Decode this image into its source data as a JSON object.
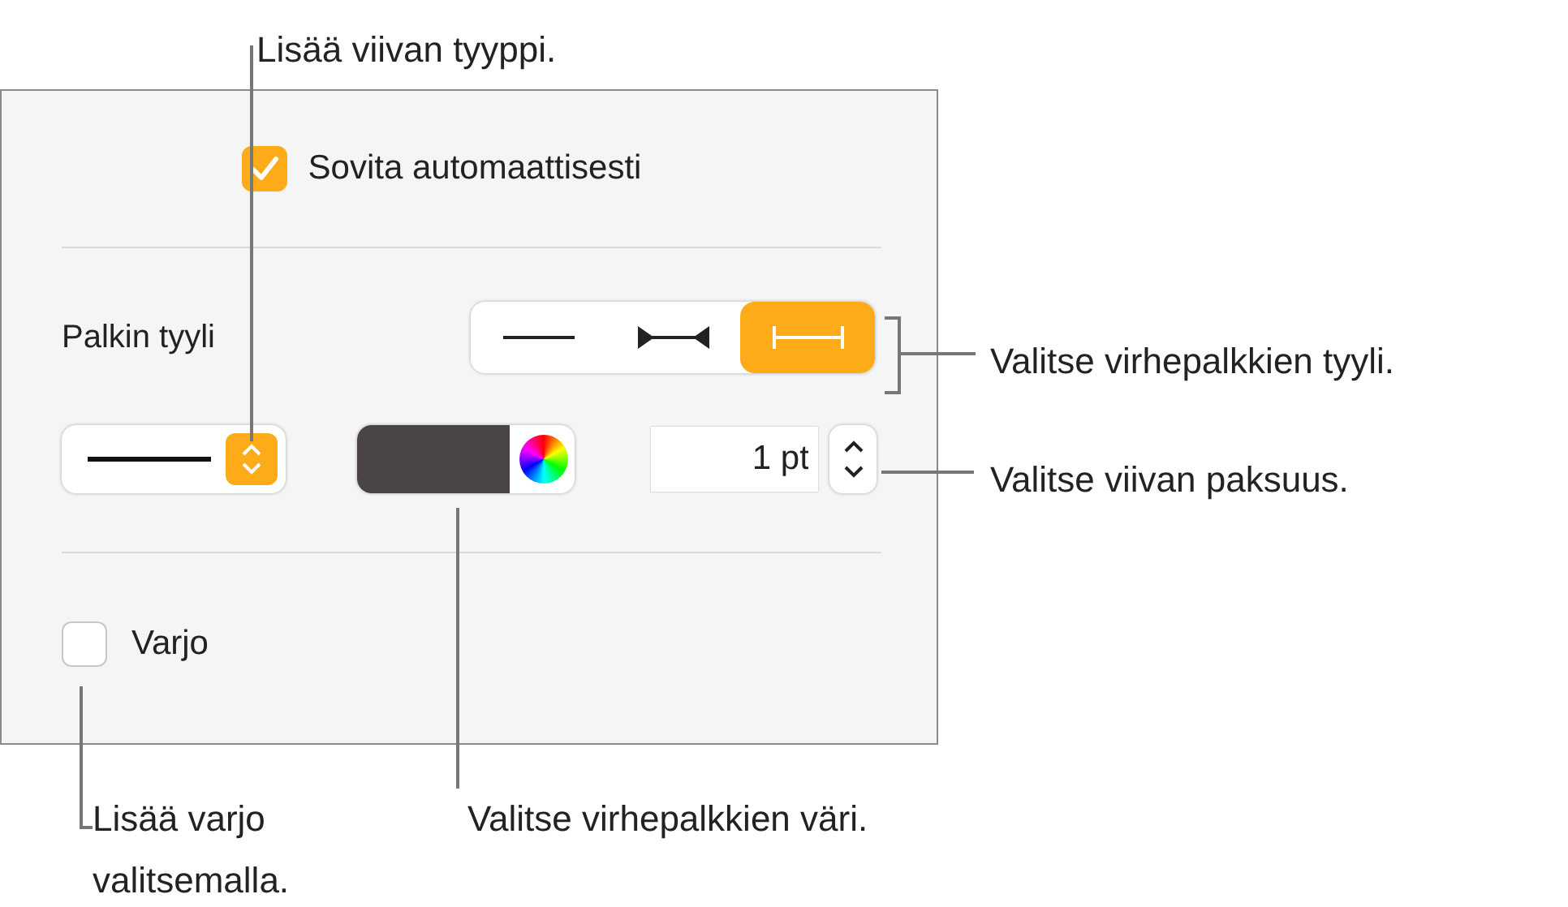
{
  "panel": {
    "auto_fit": {
      "label": "Sovita automaattisesti",
      "checked": true
    },
    "bar_style": {
      "label": "Palkin tyyli",
      "segments": [
        {
          "kind": "line",
          "selected": false
        },
        {
          "kind": "arrows",
          "selected": false
        },
        {
          "kind": "caps",
          "selected": true
        }
      ]
    },
    "line_style": {
      "kind": "solid"
    },
    "stroke_color": {
      "color": "#4a4444"
    },
    "thickness": {
      "value": "1 pt"
    },
    "shadow": {
      "label": "Varjo",
      "checked": false
    }
  },
  "callouts": [
    {
      "kind": "line_style",
      "text": "Lisää viivan tyyppi."
    },
    {
      "kind": "bar_style",
      "text": "Valitse virhepalkkien tyyli."
    },
    {
      "kind": "thickness",
      "text": "Valitse viivan paksuus."
    },
    {
      "kind": "shadow",
      "text": "Lisää varjo valitsemalla."
    },
    {
      "kind": "color",
      "text": "Valitse virhepalkkien väri."
    }
  ]
}
